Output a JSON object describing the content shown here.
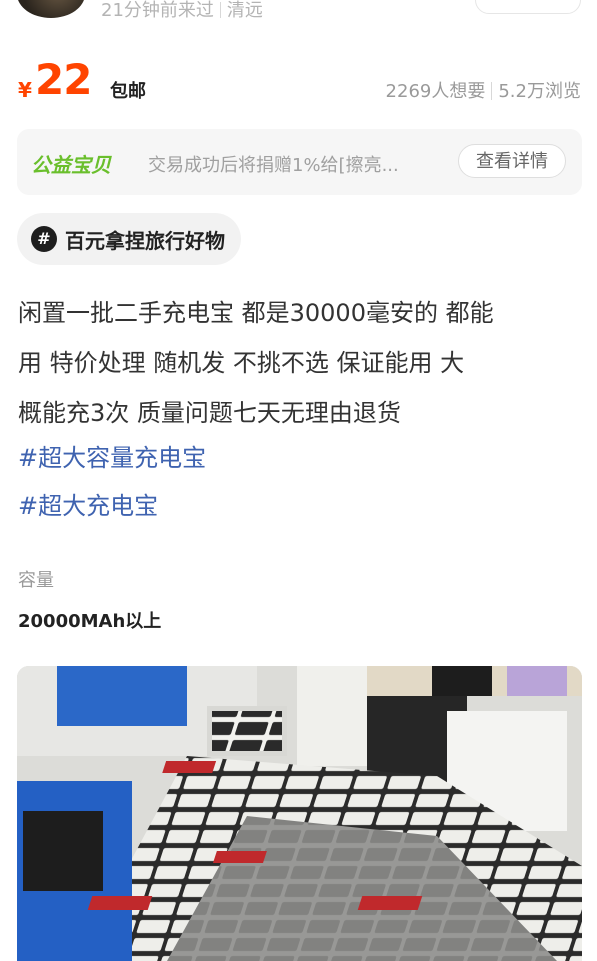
{
  "seller": {
    "last_seen": "21分钟前来过",
    "location": "清远"
  },
  "listing": {
    "currency": "¥",
    "price": "22",
    "shipping": "包邮",
    "want_count": "2269人想要",
    "views": "5.2万浏览"
  },
  "charity": {
    "tag": "公益宝贝",
    "text": "交易成功后将捐赠1%给[擦亮...",
    "button": "查看详情"
  },
  "topic": {
    "icon": "#",
    "label": "百元拿捏旅行好物"
  },
  "description": {
    "lines": [
      "闲置一批二手充电宝  都是30000毫安的    都能",
      "用  特价处理   随机发  不挑不选  保证能用  大",
      "概能充3次   质量问题七天无理由退货"
    ],
    "hashtags": [
      "#超大容量充电宝",
      "#超大充电宝"
    ]
  },
  "attributes": {
    "capacity_label": "容量",
    "capacity_value": "20000MAh以上"
  },
  "photo": {
    "icon": "product-photo-power-banks"
  },
  "colors": {
    "price": "#ff4400",
    "charity_tag": "#6abf2c",
    "hashtag": "#3f63b0"
  }
}
